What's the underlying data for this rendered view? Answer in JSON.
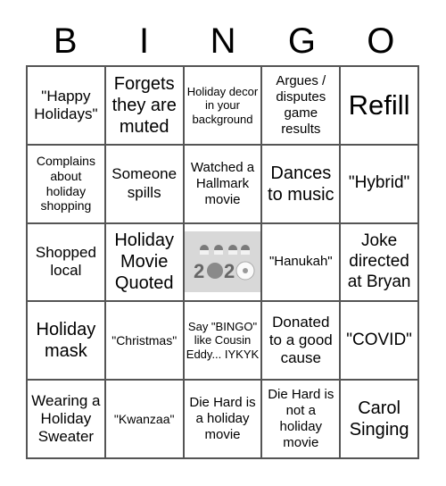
{
  "header": [
    "B",
    "I",
    "N",
    "G",
    "O"
  ],
  "cells": [
    {
      "text": "\"Happy Holidays\"",
      "size": "s17"
    },
    {
      "text": "Forgets they are muted",
      "size": "s20"
    },
    {
      "text": "Holiday decor in your background",
      "size": "s13"
    },
    {
      "text": "Argues / disputes game results",
      "size": "s15"
    },
    {
      "text": "Refill",
      "size": "s31"
    },
    {
      "text": "Complains about holiday shopping",
      "size": "s14"
    },
    {
      "text": "Someone spills",
      "size": "s17"
    },
    {
      "text": "Watched a Hallmark movie",
      "size": "s15"
    },
    {
      "text": "Dances to music",
      "size": "s20"
    },
    {
      "text": "\"Hybrid\"",
      "size": "s19"
    },
    {
      "text": "Shopped local",
      "size": "s17"
    },
    {
      "text": "Holiday Movie Quoted",
      "size": "s20"
    },
    {
      "text": "",
      "image": "free-space-2020-reindeer-image"
    },
    {
      "text": "\"Hanukah\"",
      "size": "s15"
    },
    {
      "text": "Joke directed at Bryan",
      "size": "s19"
    },
    {
      "text": "Holiday mask",
      "size": "s20"
    },
    {
      "text": "\"Christmas\"",
      "size": "s14"
    },
    {
      "text": "Say \"BINGO\" like Cousin Eddy... IYKYK",
      "size": "s13"
    },
    {
      "text": "Donated to a good cause",
      "size": "s17"
    },
    {
      "text": "\"COVID\"",
      "size": "s19"
    },
    {
      "text": "Wearing a Holiday Sweater",
      "size": "s17"
    },
    {
      "text": "\"Kwanzaa\"",
      "size": "s14"
    },
    {
      "text": "Die Hard is a holiday movie",
      "size": "s15"
    },
    {
      "text": "Die Hard is not a holiday movie",
      "size": "s15"
    },
    {
      "text": "Carol Singing",
      "size": "s20"
    }
  ]
}
